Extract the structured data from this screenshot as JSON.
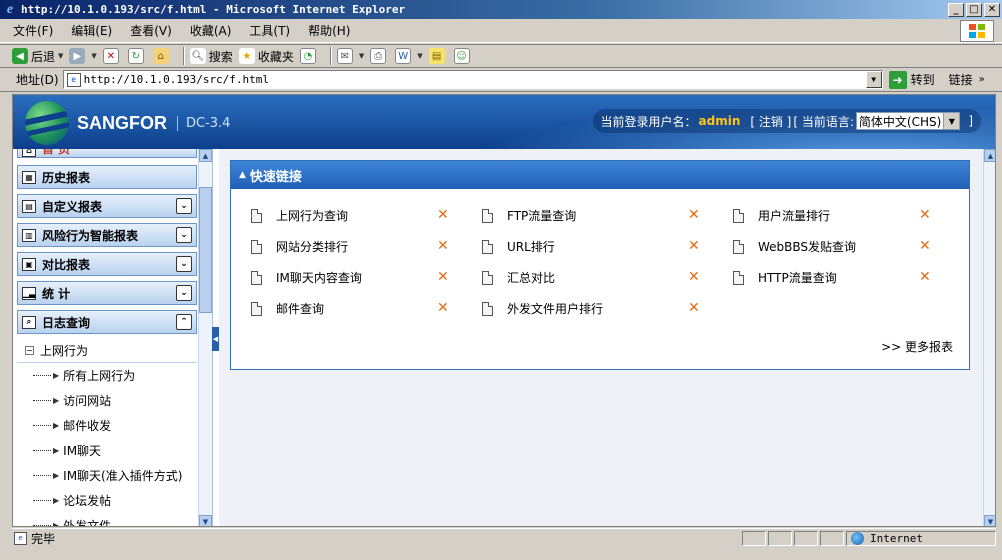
{
  "window": {
    "title": "http://10.1.0.193/src/f.html - Microsoft Internet Explorer"
  },
  "menubar": {
    "items": [
      "文件(F)",
      "编辑(E)",
      "查看(V)",
      "收藏(A)",
      "工具(T)",
      "帮助(H)"
    ]
  },
  "toolbar": {
    "back": "后退",
    "search": "搜索",
    "favorites": "收藏夹"
  },
  "address": {
    "label": "地址(D)",
    "url": "http://10.1.0.193/src/f.html",
    "go": "转到",
    "links": "链接"
  },
  "header": {
    "brand": "SANGFOR",
    "version": "DC-3.4",
    "user_label": "当前登录用户名：",
    "username": "admin",
    "logout": "[ 注销 ]",
    "lang_label": "[ 当前语言:",
    "lang_value": "简体中文(CHS)",
    "lang_close": "]"
  },
  "sidebar": {
    "home": "首 页",
    "sections": [
      {
        "label": "历史报表"
      },
      {
        "label": "自定义报表"
      },
      {
        "label": "风险行为智能报表"
      },
      {
        "label": "对比报表"
      },
      {
        "label": "统 计"
      },
      {
        "label": "日志查询"
      }
    ],
    "expanded_group": "上网行为",
    "sub_items": [
      "所有上网行为",
      "访问网站",
      "邮件收发",
      "IM聊天",
      "IM聊天(准入插件方式)",
      "论坛发帖",
      "外发文件"
    ]
  },
  "panel": {
    "title": "快速链接",
    "links": [
      "上网行为查询",
      "FTP流量查询",
      "用户流量排行",
      "网站分类排行",
      "URL排行",
      "WebBBS发贴查询",
      "IM聊天内容查询",
      "汇总对比",
      "HTTP流量查询",
      "邮件查询",
      "外发文件用户排行"
    ],
    "more": ">> 更多报表"
  },
  "status": {
    "text": "完毕",
    "zone": "Internet"
  },
  "colors": {
    "brand_blue": "#1f5fb6",
    "accent_orange": "#e86b12",
    "username": "#ffc41a"
  }
}
